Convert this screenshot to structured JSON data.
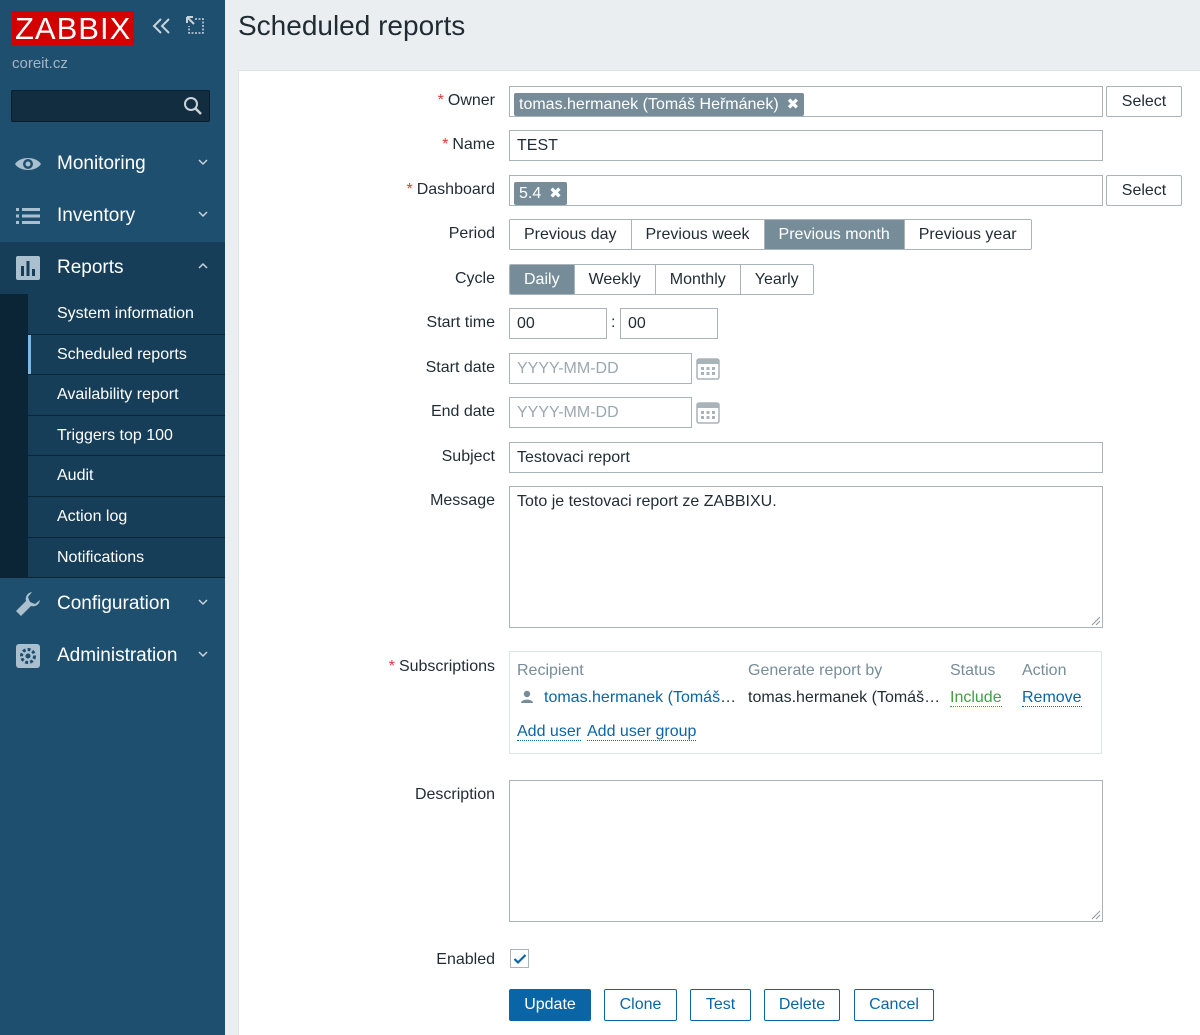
{
  "sidebar": {
    "logo": "ZABBIX",
    "server_name": "coreit.cz",
    "menu": [
      {
        "label": "Monitoring",
        "icon": "eye-icon"
      },
      {
        "label": "Inventory",
        "icon": "list-icon"
      },
      {
        "label": "Reports",
        "icon": "bar-chart-icon"
      },
      {
        "label": "Configuration",
        "icon": "wrench-icon"
      },
      {
        "label": "Administration",
        "icon": "gear-icon"
      }
    ],
    "reports_submenu": [
      "System information",
      "Scheduled reports",
      "Availability report",
      "Triggers top 100",
      "Audit",
      "Action log",
      "Notifications"
    ]
  },
  "page": {
    "title": "Scheduled reports"
  },
  "form": {
    "owner_label": "Owner",
    "owner_value": "tomas.hermanek (Tomáš Heřmánek)",
    "name_label": "Name",
    "name_value": "TEST",
    "dashboard_label": "Dashboard",
    "dashboard_value": "5.4",
    "select_label": "Select",
    "period_label": "Period",
    "period_options": [
      "Previous day",
      "Previous week",
      "Previous month",
      "Previous year"
    ],
    "period_selected": "Previous month",
    "cycle_label": "Cycle",
    "cycle_options": [
      "Daily",
      "Weekly",
      "Monthly",
      "Yearly"
    ],
    "cycle_selected": "Daily",
    "start_time_label": "Start time",
    "start_time_hours": "00",
    "start_time_minutes": "00",
    "start_date_label": "Start date",
    "end_date_label": "End date",
    "date_placeholder": "YYYY-MM-DD",
    "subject_label": "Subject",
    "subject_value": "Testovaci report",
    "message_label": "Message",
    "message_value": "Toto je testovaci report ze ZABBIXU.",
    "subscriptions_label": "Subscriptions",
    "subscriptions": {
      "headers": [
        "Recipient",
        "Generate report by",
        "Status",
        "Action"
      ],
      "rows": [
        {
          "recipient": "tomas.hermanek (Tomáš …",
          "generate_by": "tomas.hermanek (Tomáš …",
          "status": "Include",
          "action": "Remove"
        }
      ],
      "add_user": "Add user",
      "add_user_group": "Add user group"
    },
    "description_label": "Description",
    "description_value": "",
    "enabled_label": "Enabled",
    "enabled": true
  },
  "buttons": {
    "update": "Update",
    "clone": "Clone",
    "test": "Test",
    "delete": "Delete",
    "cancel": "Cancel"
  },
  "colors": {
    "sidebar": "#1f4f6f",
    "logo_red": "#d40000",
    "primary": "#0a65a7",
    "segment_selected": "#768d99",
    "required": "#e33734",
    "include_green": "#429e47"
  }
}
